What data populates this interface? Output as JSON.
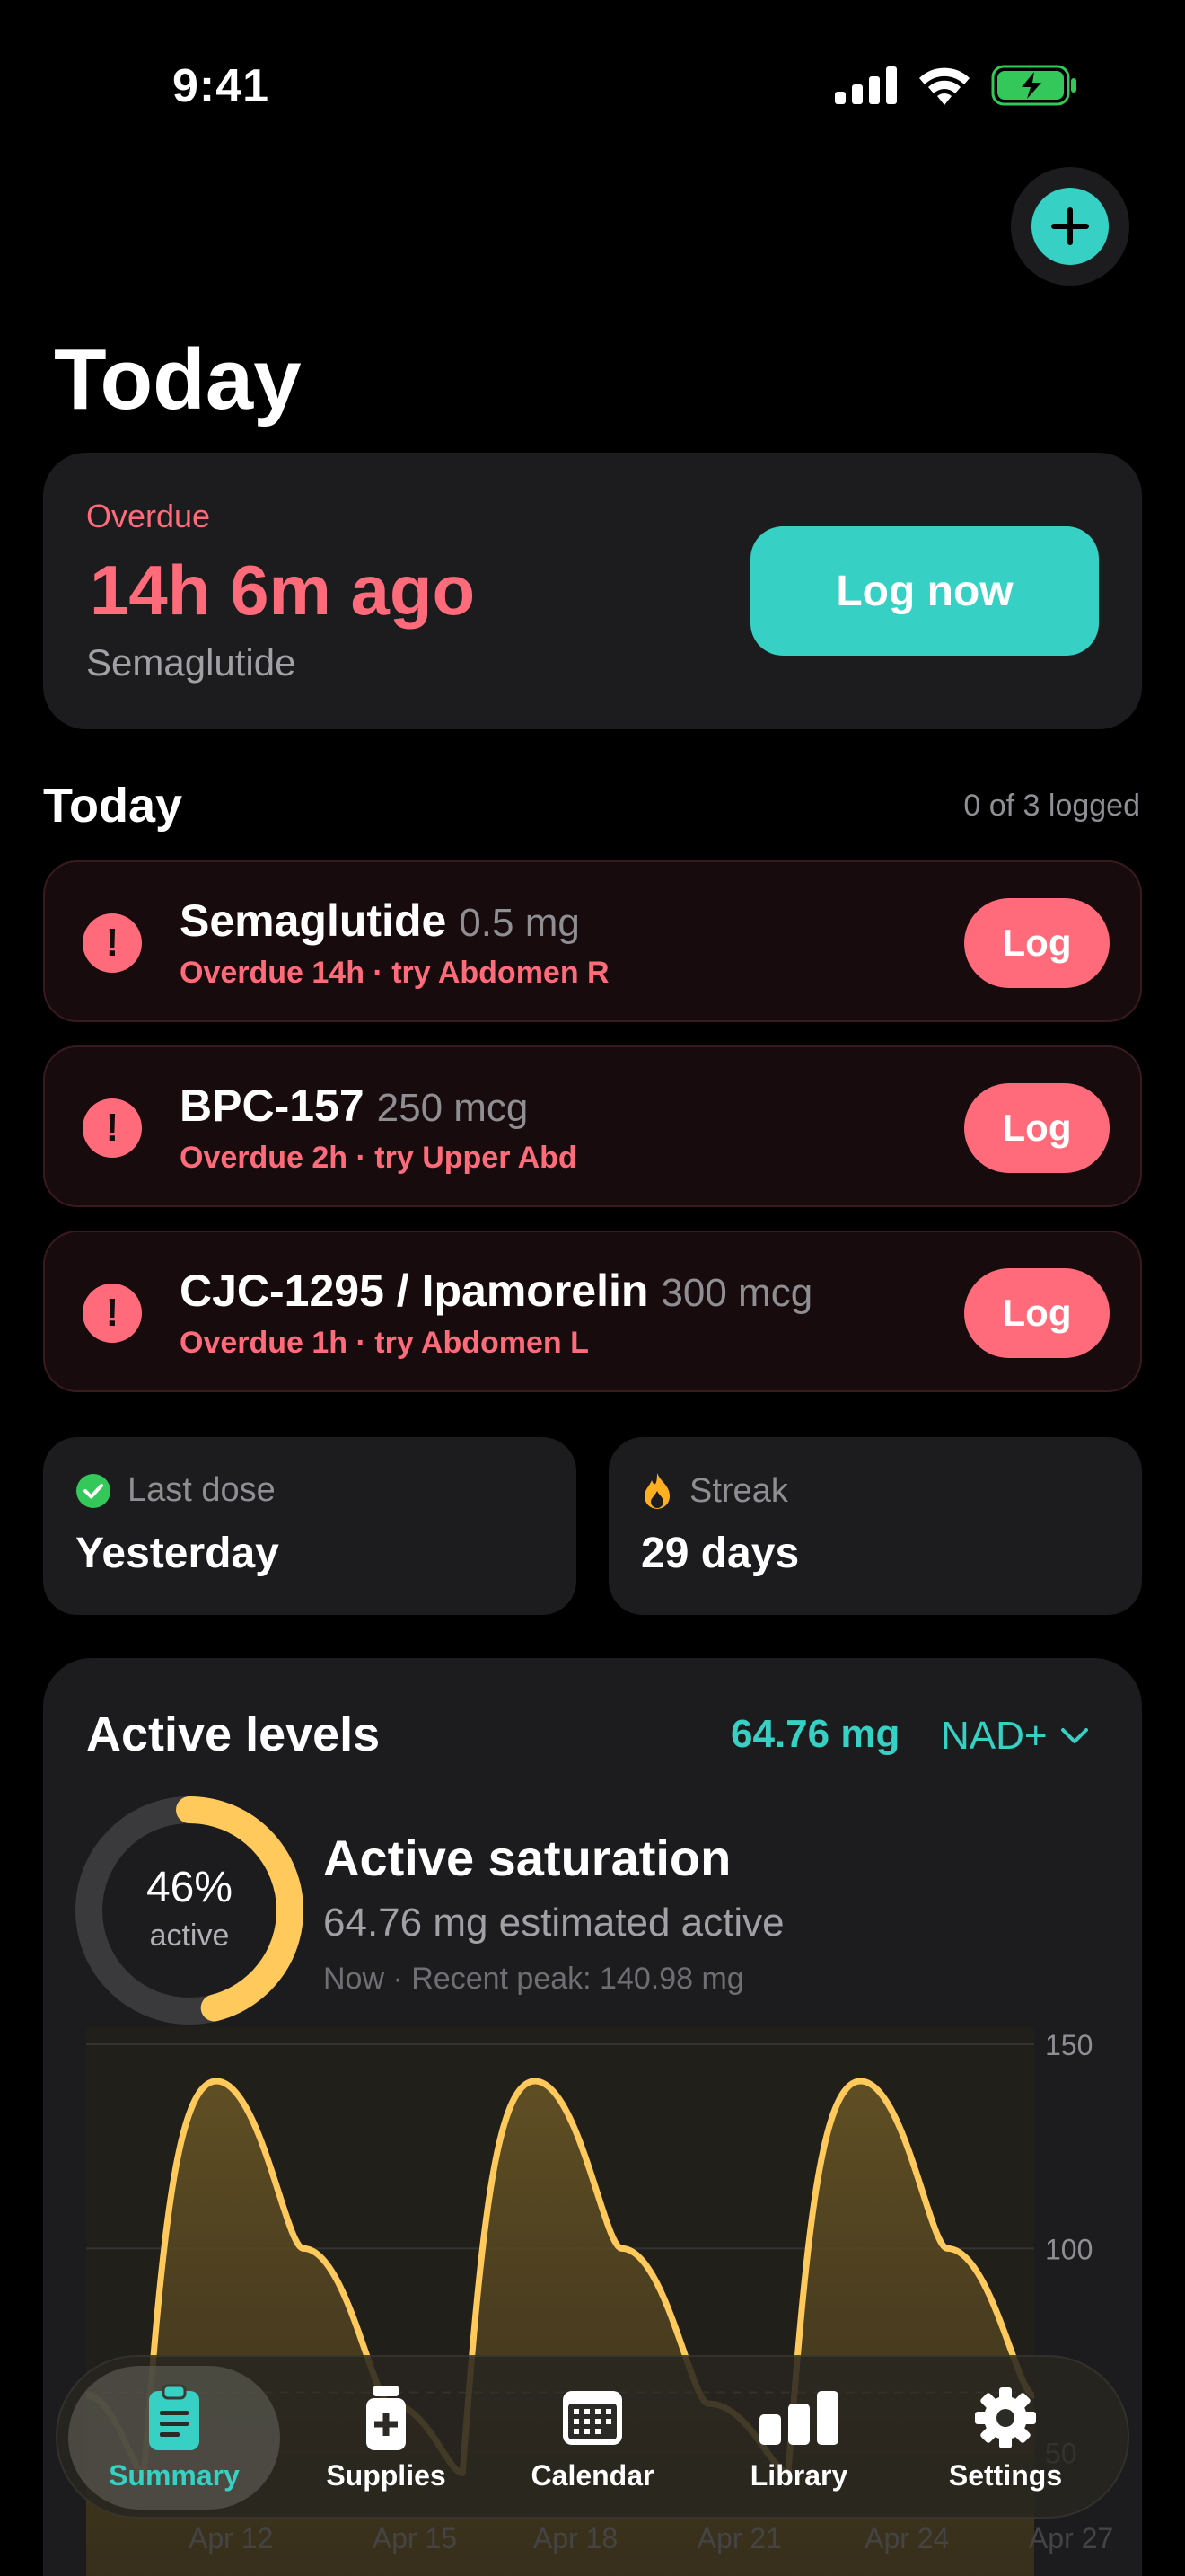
{
  "status_bar": {
    "time": "9:41"
  },
  "header": {
    "title": "Today"
  },
  "hero": {
    "status": "Overdue",
    "ago": "14h 6m ago",
    "medication": "Semaglutide",
    "button_label": "Log now"
  },
  "schedule": {
    "title": "Today",
    "count_text": "0 of 3 logged",
    "items": [
      {
        "name": "Semaglutide",
        "amount": "0.5 mg",
        "sub": "Overdue 14h · try Abdomen R",
        "button": "Log"
      },
      {
        "name": "BPC-157",
        "amount": "250 mcg",
        "sub": "Overdue 2h · try Upper Abd",
        "button": "Log"
      },
      {
        "name": "CJC-1295 / Ipamorelin",
        "amount": "300 mcg",
        "sub": "Overdue 1h · try Abdomen L",
        "button": "Log"
      }
    ]
  },
  "stats": {
    "last_dose": {
      "label": "Last dose",
      "value": "Yesterday",
      "icon": "check-circle-icon"
    },
    "streak": {
      "label": "Streak",
      "value": "29 days",
      "icon": "flame-icon"
    }
  },
  "levels": {
    "title": "Active levels",
    "amount": "64.76 mg",
    "compound": "NAD+",
    "ring_percent_label": "46%",
    "ring_percent": 0.46,
    "ring_sub": "active",
    "saturation_title": "Active saturation",
    "estimate_text": "64.76 mg estimated active",
    "peak_text": "Now · Recent peak: 140.98 mg"
  },
  "chart_data": {
    "type": "area",
    "y_ticks": [
      "150",
      "100",
      "50"
    ],
    "ylim": [
      0,
      150
    ],
    "threshold": 64.76,
    "x_ticks": [
      "Apr 12",
      "Apr 15",
      "Apr 18",
      "Apr 21",
      "Apr 24",
      "Apr 27",
      "..."
    ],
    "series": [
      {
        "points": [
          [
            0,
            64
          ],
          [
            0.8,
            45
          ],
          [
            1.8,
            140.98
          ],
          [
            3.0,
            100
          ],
          [
            4.2,
            62
          ],
          [
            5.2,
            45
          ],
          [
            6.2,
            140.98
          ],
          [
            7.4,
            100
          ],
          [
            8.6,
            62
          ],
          [
            9.7,
            45
          ],
          [
            10.7,
            140.98
          ],
          [
            11.9,
            100
          ],
          [
            13.1,
            64
          ]
        ]
      }
    ],
    "colors": {
      "line": "#ffc95c",
      "fill": "#5a4a22",
      "threshold": "#7a7a7a"
    }
  },
  "tabs": [
    {
      "label": "Summary",
      "icon": "clipboard-icon",
      "active": true
    },
    {
      "label": "Supplies",
      "icon": "medicine-bottle-icon",
      "active": false
    },
    {
      "label": "Calendar",
      "icon": "calendar-icon",
      "active": false
    },
    {
      "label": "Library",
      "icon": "bar-chart-icon",
      "active": false
    },
    {
      "label": "Settings",
      "icon": "gear-icon",
      "active": false
    }
  ],
  "colors": {
    "accent": "#36d1c4",
    "danger": "#ff6b7a",
    "gold": "#ffc95c",
    "card": "#1c1c1e"
  }
}
